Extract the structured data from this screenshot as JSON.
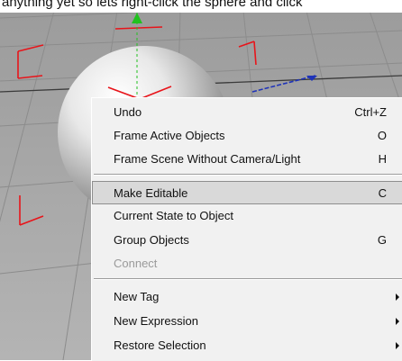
{
  "caption": "anything yet so lets right-click the sphere and click",
  "colors": {
    "viewport_bg": "#a7a7a7",
    "grid_line": "#8c8c8c",
    "horizon": "#3a3a3a",
    "corner_mark": "#e8141a",
    "axis_green": "#21c21f",
    "axis_blue": "#1f33b8",
    "menu_bg": "#f1f1f1",
    "menu_highlight": "#d9d9d9",
    "disabled_text": "#9a9a9a"
  },
  "context_menu": {
    "items": [
      {
        "label": "Undo",
        "shortcut": "Ctrl+Z"
      },
      {
        "label": "Frame Active Objects",
        "shortcut": "O"
      },
      {
        "label": "Frame Scene Without Camera/Light",
        "shortcut": "H"
      },
      {
        "label": "Make Editable",
        "shortcut": "C",
        "highlighted": true
      },
      {
        "label": "Current State to Object",
        "shortcut": ""
      },
      {
        "label": "Group Objects",
        "shortcut": "G"
      },
      {
        "label": "Connect",
        "shortcut": "",
        "disabled": true
      },
      {
        "label": "New Tag",
        "submenu": true
      },
      {
        "label": "New Expression",
        "submenu": true
      },
      {
        "label": "Restore Selection",
        "submenu": true
      }
    ]
  }
}
